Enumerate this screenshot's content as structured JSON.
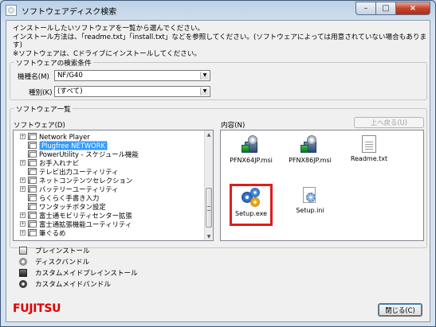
{
  "window": {
    "title": "ソフトウェアディスク検索",
    "close_glyph": "×",
    "minimize_glyph": "–",
    "maximize_glyph": "□"
  },
  "instructions": [
    "インストールしたいソフトウェアを一覧から選んでください。",
    "インストール方法は、「readme.txt」「install.txt」などを参照してください。(ソフトウェアによっては用意されていない場合もあります)",
    "※ソフトウェアは、Cドライブにインストールしてください。"
  ],
  "search": {
    "group_label": "ソフトウェアの検索条件",
    "model_label": "機種名(M)",
    "model_value": "NF/G40",
    "type_label": "種別(K)",
    "type_value": "(すべて)"
  },
  "software_list": {
    "group_label": "ソフトウェア一覧",
    "tree_label": "ソフトウェア(D)",
    "contents_label": "内容(N)",
    "up_button": "上へ戻る(U)",
    "tree_items": [
      {
        "label": "Network Player",
        "expander": "+",
        "selected": false
      },
      {
        "label": "Plugfree NETWORK",
        "expander": "",
        "selected": true
      },
      {
        "label": "PowerUtility - スケジュール機能",
        "expander": "",
        "selected": false
      },
      {
        "label": "お手入れナビ",
        "expander": "+",
        "selected": false
      },
      {
        "label": "テレビ出力ユーティリティ",
        "expander": "",
        "selected": false
      },
      {
        "label": "ネットコンテンツセレクション",
        "expander": "+",
        "selected": false
      },
      {
        "label": "バッテリーユーティリティ",
        "expander": "+",
        "selected": false
      },
      {
        "label": "らくらく手書き入力",
        "expander": "",
        "selected": false
      },
      {
        "label": "ワンタッチボタン設定",
        "expander": "",
        "selected": false
      },
      {
        "label": "富士通モビリティセンター拡張",
        "expander": "+",
        "selected": false
      },
      {
        "label": "富士通拡張機能ユーティリティ",
        "expander": "+",
        "selected": false
      },
      {
        "label": "筆ぐるめ",
        "expander": "+",
        "selected": false
      }
    ],
    "files": [
      {
        "name": "PFNX64JP.msi",
        "icon": "msi-installer-icon"
      },
      {
        "name": "PFNX86JP.msi",
        "icon": "msi-installer-icon"
      },
      {
        "name": "Readme.txt",
        "icon": "text-file-icon"
      },
      {
        "name": "Setup.exe",
        "icon": "setup-exe-icon"
      },
      {
        "name": "Setup.ini",
        "icon": "ini-settings-icon"
      }
    ]
  },
  "legend": [
    {
      "label": "プレインストール",
      "icon": "preinstall-icon"
    },
    {
      "label": "ディスクバンドル",
      "icon": "disc-bundle-icon"
    },
    {
      "label": "カスタムメイドプレインストール",
      "icon": "custom-preinstall-icon"
    },
    {
      "label": "カスタムメイドバンドル",
      "icon": "custom-bundle-icon"
    }
  ],
  "footer": {
    "logo": "FUJITSU",
    "close_button": "閉じる(C)"
  },
  "colors": {
    "highlight": "#e21b1b",
    "selection": "#3399ff",
    "logo": "#e00000"
  }
}
